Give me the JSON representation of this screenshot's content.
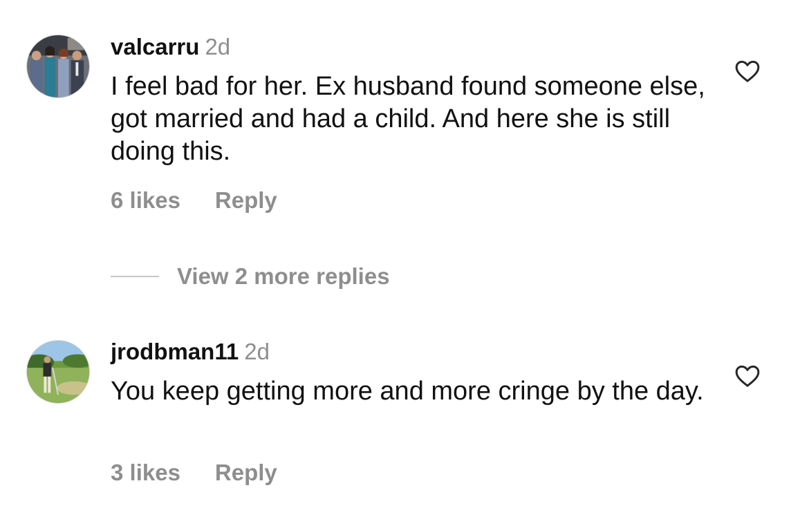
{
  "comments": [
    {
      "username": "valcarru",
      "time": "2d",
      "text": "I feel bad for her. Ex husband found someone else, got married and had a child. And here she is still doing this.",
      "likes": "6 likes",
      "reply_label": "Reply",
      "avatar_icon": "group-photo-avatar",
      "like_icon": "heart-outline-icon"
    },
    {
      "username": "jrodbman11",
      "time": "2d",
      "text": "You keep getting more and more cringe by the day.",
      "likes": "3 likes",
      "reply_label": "Reply",
      "avatar_icon": "golf-course-photo-avatar",
      "like_icon": "heart-outline-icon"
    }
  ],
  "view_more_replies": "View 2 more replies",
  "colors": {
    "text_primary": "#111111",
    "text_secondary": "#8e8e8e",
    "divider": "#c7c7c7",
    "background": "#ffffff"
  }
}
